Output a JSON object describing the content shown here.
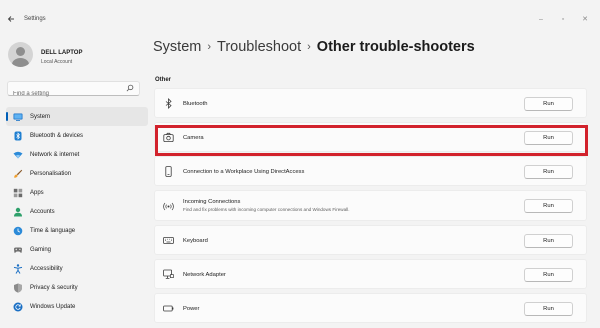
{
  "window": {
    "title": "Settings",
    "back_icon": "back-arrow-icon",
    "minimize": "–",
    "maximize": "▫",
    "close": "✕"
  },
  "profile": {
    "name": "DELL LAPTOP",
    "account": "Local Account"
  },
  "search": {
    "placeholder": "Find a setting"
  },
  "sidebar": {
    "items": [
      {
        "label": "System",
        "icon": "system-icon",
        "selected": true
      },
      {
        "label": "Bluetooth & devices",
        "icon": "bluetooth-devices-icon"
      },
      {
        "label": "Network & internet",
        "icon": "network-icon"
      },
      {
        "label": "Personalisation",
        "icon": "brush-icon"
      },
      {
        "label": "Apps",
        "icon": "apps-icon"
      },
      {
        "label": "Accounts",
        "icon": "accounts-icon"
      },
      {
        "label": "Time & language",
        "icon": "globe-clock-icon"
      },
      {
        "label": "Gaming",
        "icon": "gamepad-icon"
      },
      {
        "label": "Accessibility",
        "icon": "accessibility-icon"
      },
      {
        "label": "Privacy & security",
        "icon": "shield-icon"
      },
      {
        "label": "Windows Update",
        "icon": "update-icon"
      }
    ]
  },
  "breadcrumb": {
    "root": "System",
    "sep1": "›",
    "middle": "Troubleshoot",
    "sep2": "›",
    "current": "Other trouble-shooters"
  },
  "section": "Other",
  "troubleshooters": [
    {
      "title": "Bluetooth",
      "icon": "bluetooth-icon",
      "button": "Run"
    },
    {
      "title": "Camera",
      "icon": "camera-icon",
      "button": "Run",
      "highlighted": true
    },
    {
      "title": "Connection to a Workplace Using DirectAccess",
      "icon": "phone-device-icon",
      "button": "Run"
    },
    {
      "title": "Incoming Connections",
      "description": "Find and fix problems with incoming computer connections and Windows Firewall.",
      "icon": "broadcast-icon",
      "button": "Run"
    },
    {
      "title": "Keyboard",
      "icon": "keyboard-icon",
      "button": "Run"
    },
    {
      "title": "Network Adapter",
      "icon": "monitor-network-icon",
      "button": "Run"
    },
    {
      "title": "Power",
      "icon": "battery-icon",
      "button": "Run"
    }
  ],
  "colors": {
    "accent": "#005fb8",
    "highlight_border": "#d2222c"
  }
}
